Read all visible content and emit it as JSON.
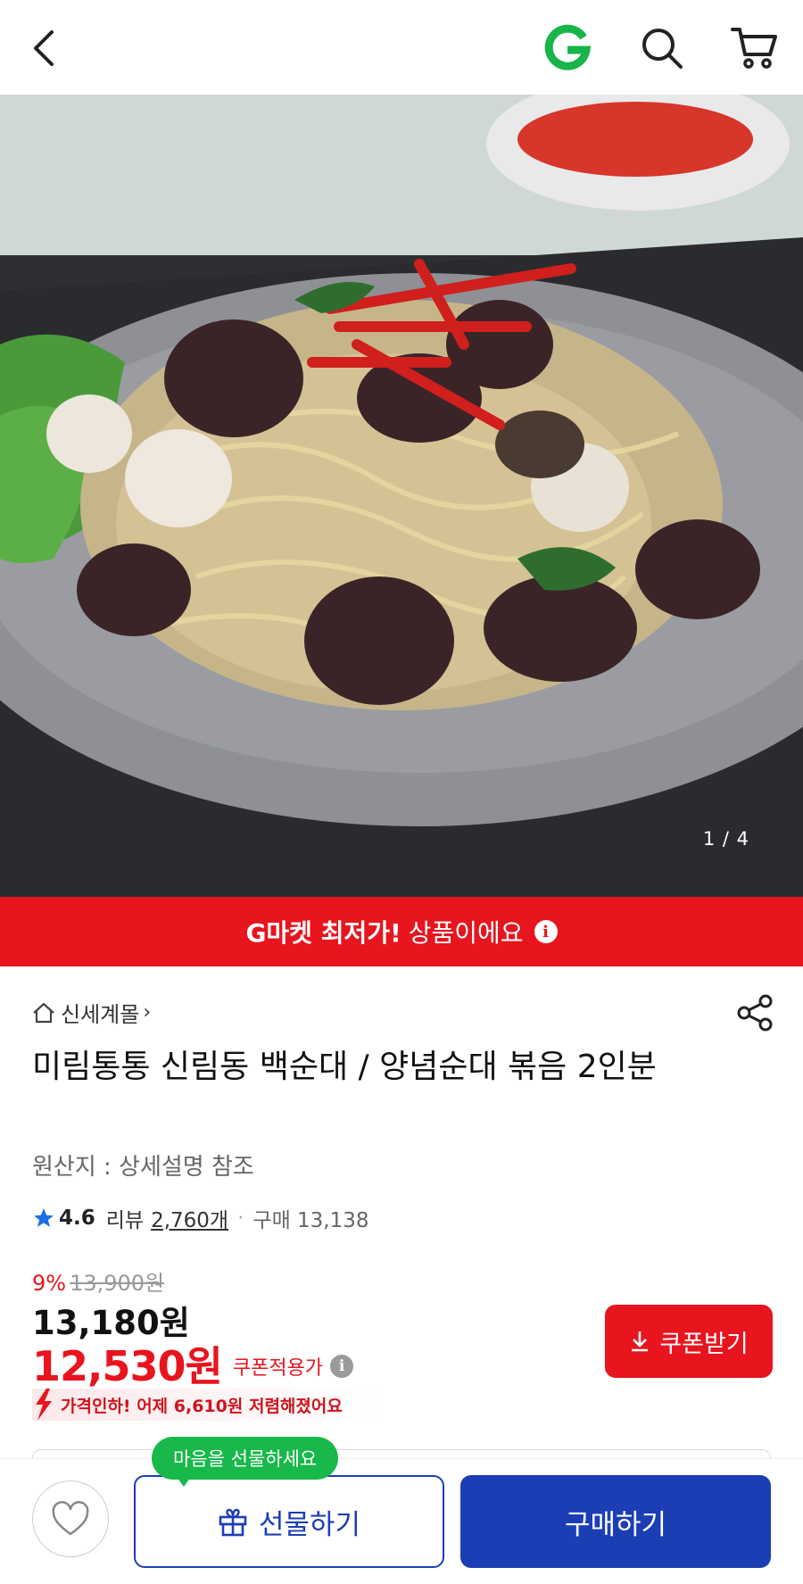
{
  "header": {
    "back_icon": "chevron-left-icon",
    "logo_letter": "G",
    "logo_color": "#19b44a",
    "search_icon": "search-icon",
    "cart_icon": "cart-icon"
  },
  "gallery": {
    "current": 1,
    "total": 4,
    "counter": "1 / 4"
  },
  "banner": {
    "bold": "G마켓 최저가!",
    "light": "상품이에요",
    "color": "#e8141e"
  },
  "product": {
    "store": "신세계몰",
    "title": "미림통통 신림동 백순대 / 양념순대 볶음 2인분",
    "origin": "원산지 : 상세설명 참조",
    "rating": "4.6",
    "review_label": "리뷰",
    "review_count": "2,760개",
    "purchase": "구매 13,138"
  },
  "price": {
    "discount": "9%",
    "original": "13,900원",
    "sale": "13,180원",
    "coupon_price": "12,530원",
    "coupon_label": "쿠폰적용가",
    "price_drop": "가격인하! 어제 6,610원 저렴해졌어요",
    "coupon_button": "쿠폰받기",
    "accent": "#e8141e"
  },
  "bottom_bar": {
    "tooltip": "마음을 선물하세요",
    "gift": "선물하기",
    "buy": "구매하기",
    "primary_color": "#1b3eb5",
    "tooltip_color": "#18b84a"
  }
}
